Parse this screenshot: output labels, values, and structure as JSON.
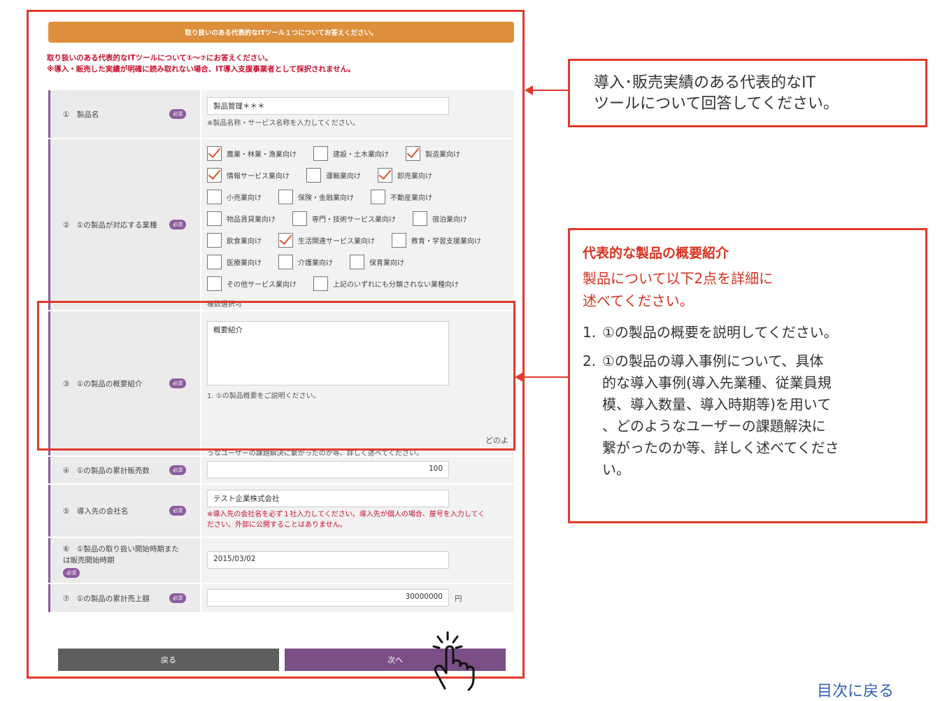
{
  "form": {
    "banner": "取り扱いのある代表的なITツール１つについてお答えください。",
    "notice_line1": "取り扱いのある代表的なITツールについて①〜⑦にお答えください。",
    "notice_line2": "※導入・販売した実績が明確に読み取れない場合、IT導入支援事業者として採択されません。",
    "required_label": "必須",
    "rows": {
      "product_name": {
        "label": "①　製品名",
        "value": "製品管理＊＊＊",
        "hint": "※製品名称・サービス名称を入力してください。"
      },
      "industries": {
        "label": "②　①の製品が対応する業種",
        "options": [
          {
            "label": "農業・林業・漁業向け",
            "checked": true
          },
          {
            "label": "建設・土木業向け",
            "checked": false
          },
          {
            "label": "製造業向け",
            "checked": true
          },
          {
            "label": "情報サービス業向け",
            "checked": true
          },
          {
            "label": "運輸業向け",
            "checked": false
          },
          {
            "label": "卸売業向け",
            "checked": true
          },
          {
            "label": "小売業向け",
            "checked": false
          },
          {
            "label": "保険・金融業向け",
            "checked": false
          },
          {
            "label": "不動産業向け",
            "checked": false
          },
          {
            "label": "物品賃貸業向け",
            "checked": false
          },
          {
            "label": "専門・技術サービス業向け",
            "checked": false
          },
          {
            "label": "宿泊業向け",
            "checked": false
          },
          {
            "label": "飲食業向け",
            "checked": false
          },
          {
            "label": "生活関連サービス業向け",
            "checked": true
          },
          {
            "label": "教育・学習支援業向け",
            "checked": false
          },
          {
            "label": "医療業向け",
            "checked": false
          },
          {
            "label": "介護業向け",
            "checked": false
          },
          {
            "label": "保育業向け",
            "checked": false
          },
          {
            "label": "その他サービス業向け",
            "checked": false
          },
          {
            "label": "上記のいずれにも分類されない業種向け",
            "checked": false
          }
        ],
        "hint": "複数選択可"
      },
      "overview": {
        "label": "③　①の製品の概要紹介",
        "value": "概要紹介",
        "hint1": "1. ①の製品概要をご説明ください。",
        "hint_right": "どのよ",
        "hint2": "うなユーザーの課題解決に繋がったのか等、詳しく述べてください。"
      },
      "sales_count": {
        "label": "④　①の製品の累計販売数",
        "value": "100"
      },
      "client_company": {
        "label": "⑤　導入先の会社名",
        "value": "テスト企業株式会社",
        "hint_line1": "※導入先の会社名を必ず１社入力してください。導入先が個人の場合、屋号を入力してく",
        "hint_line2": "ださい。外部に公開することはありません。"
      },
      "start_date": {
        "label_line1": "⑥　①製品の取り扱い開始時期また",
        "label_line2": "は販売開始時期",
        "value": "2015/03/02"
      },
      "sales_amount": {
        "label": "⑦　①の製品の累計売上額",
        "value": "30000000",
        "unit": "円"
      }
    },
    "back_button": "戻る",
    "next_button": "次へ"
  },
  "callout1": {
    "line1": "導入･販売実績のある代表的なIT",
    "line2": "ツールについて回答してください。"
  },
  "callout2": {
    "title": "代表的な製品の概要紹介",
    "sub_line1": "製品について以下2点を詳細に",
    "sub_line2": "述べてください。",
    "item1_num": "1.",
    "item1": "①の製品の概要を説明してください。",
    "item2_num": "2.",
    "item2_l1": "①の製品の導入事例について、具体",
    "item2_l2": "的な導入事例(導入先業種、従業員規",
    "item2_l3": "模、導入数量、導入時期等)を用いて",
    "item2_l4": "、どのようなユーザーの課題解決に",
    "item2_l5": "繋がったのか等、詳しく述べてくださ",
    "item2_l6": "い。"
  },
  "toc_link": "目次に戻る",
  "colors": {
    "highlight_red": "#e03a2c",
    "banner_orange": "#dd8f3c",
    "accent_purple": "#7a4f86"
  }
}
